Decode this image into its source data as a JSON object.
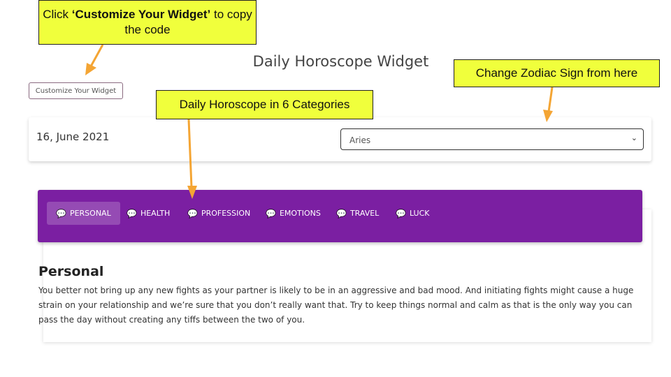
{
  "annotations": {
    "customize": {
      "pre": "Click ",
      "bold": "‘Customize Your Widget’",
      "post": " to copy the code"
    },
    "categories": "Daily Horoscope in 6 Categories",
    "zodiac": "Change Zodiac Sign from here",
    "arrow_color": "#f4a534"
  },
  "title": "Daily Horoscope Widget",
  "customize_button": "Customize Your Widget",
  "date": "16, June 2021",
  "zodiac_select": {
    "value": "Aries"
  },
  "tabs": [
    {
      "label": "PERSONAL",
      "icon": "chat-bubble-icon"
    },
    {
      "label": "HEALTH",
      "icon": "chat-bubble-icon"
    },
    {
      "label": "PROFESSION",
      "icon": "chat-bubble-icon"
    },
    {
      "label": "EMOTIONS",
      "icon": "chat-bubble-icon"
    },
    {
      "label": "TRAVEL",
      "icon": "chat-bubble-icon"
    },
    {
      "label": "LUCK",
      "icon": "chat-bubble-icon"
    }
  ],
  "accent": "#7b1fa2",
  "content": {
    "heading": "Personal",
    "text": "You better not bring up any new fights as your partner is likely to be in an aggressive and bad mood. And initiating fights might cause a huge strain on your relationship and we’re sure that you don’t really want that. Try to keep things normal and calm as that is the only way you can pass the day without creating any tiffs between the two of you."
  }
}
